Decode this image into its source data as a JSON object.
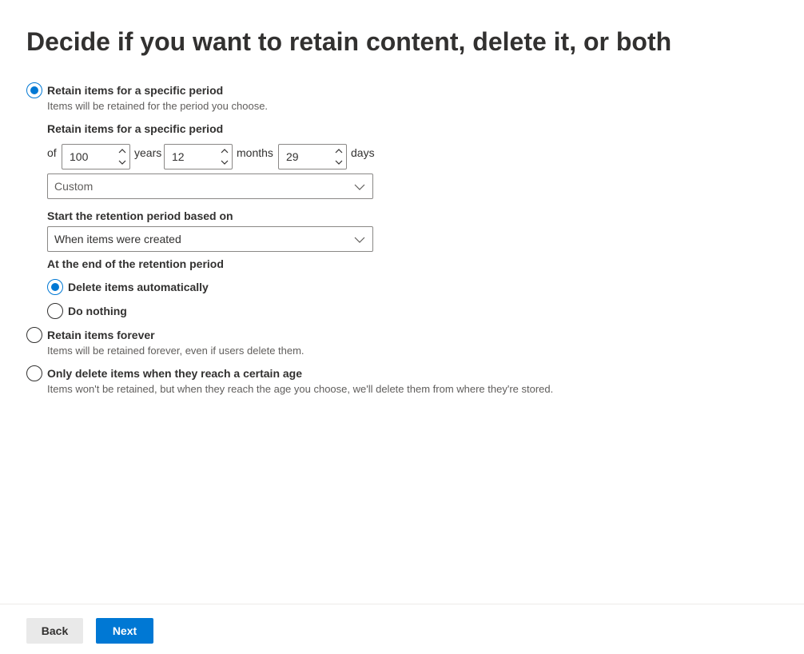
{
  "page": {
    "title": "Decide if you want to retain content, delete it, or both"
  },
  "options": {
    "retain_specific": {
      "label": "Retain items for a specific period",
      "description": "Items will be retained for the period you choose.",
      "selected": true
    },
    "retain_forever": {
      "label": "Retain items forever",
      "description": "Items will be retained forever, even if users delete them.",
      "selected": false
    },
    "delete_only": {
      "label": "Only delete items when they reach a certain age",
      "description": "Items won't be retained, but when they reach the age you choose, we'll delete them from where they're stored.",
      "selected": false
    }
  },
  "period": {
    "section_label": "Retain items for a specific period",
    "of_label": "of",
    "years": {
      "value": "100",
      "unit": "years"
    },
    "months": {
      "value": "12",
      "unit": "months"
    },
    "days": {
      "value": "29",
      "unit": "days"
    },
    "preset": {
      "selected": "Custom"
    }
  },
  "start": {
    "label": "Start the retention period based on",
    "selected": "When items were created"
  },
  "end": {
    "label": "At the end of the retention period",
    "delete_auto": {
      "label": "Delete items automatically",
      "selected": true
    },
    "do_nothing": {
      "label": "Do nothing",
      "selected": false
    }
  },
  "footer": {
    "back_label": "Back",
    "next_label": "Next"
  },
  "colors": {
    "accent": "#0078d4",
    "text": "#323130",
    "secondary_text": "#605e5c",
    "border": "#8a8886",
    "back_button_bg": "#e9e9e9"
  },
  "icons": {
    "spin_up": "chevron-up-icon",
    "spin_down": "chevron-down-icon",
    "dropdown": "chevron-down-icon"
  }
}
